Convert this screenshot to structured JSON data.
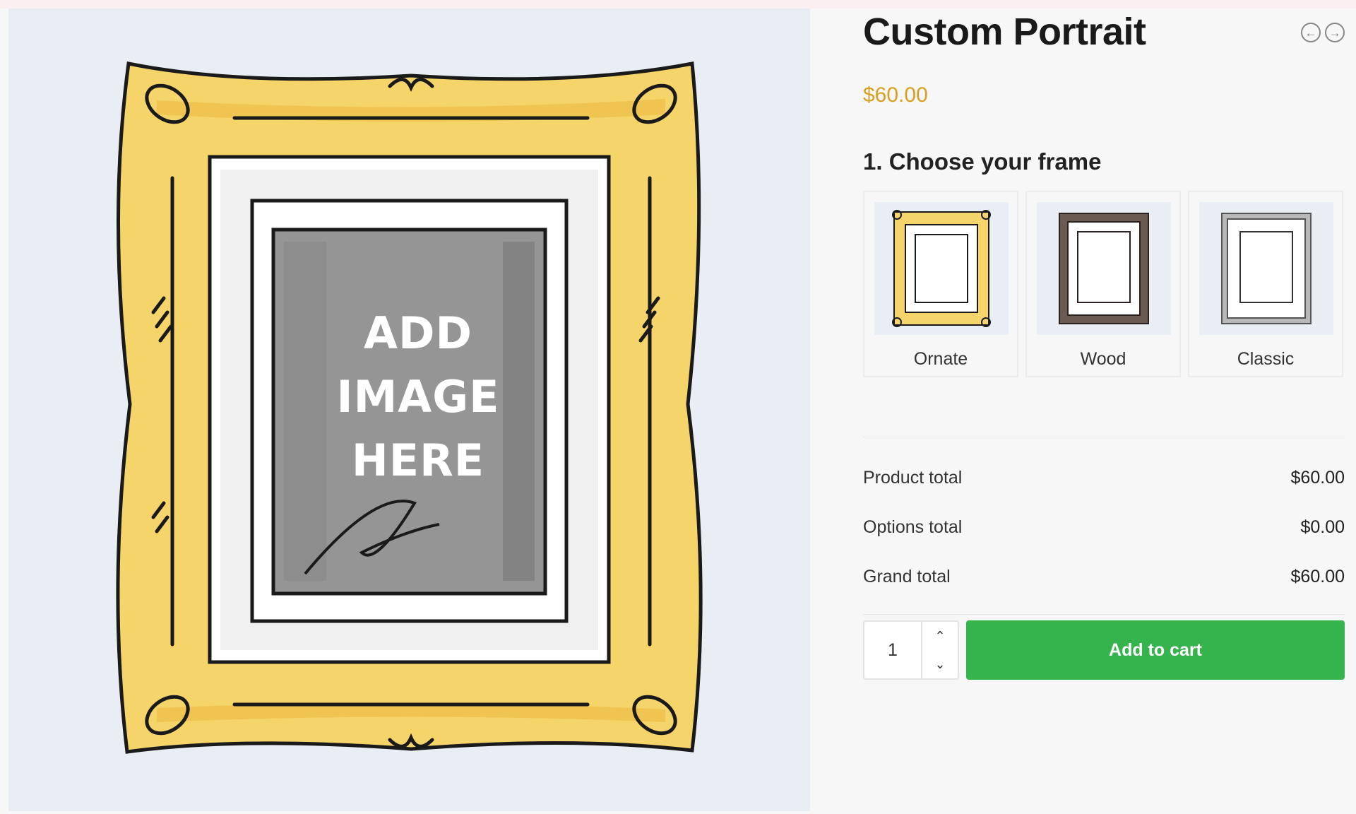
{
  "product": {
    "title": "Custom Portrait",
    "price": "$60.00",
    "image_placeholder": [
      "ADD",
      "IMAGE",
      "HERE"
    ]
  },
  "nav": {
    "prev_icon": "arrow-left-circle-icon",
    "next_icon": "arrow-right-circle-icon"
  },
  "options": {
    "heading": "1. Choose your frame",
    "frames": [
      {
        "label": "Ornate",
        "color": "#f2c94c"
      },
      {
        "label": "Wood",
        "color": "#6b5a52"
      },
      {
        "label": "Classic",
        "color": "#b8b8b8"
      }
    ]
  },
  "totals": {
    "product_label": "Product total",
    "product_value": "$60.00",
    "options_label": "Options total",
    "options_value": "$0.00",
    "grand_label": "Grand total",
    "grand_value": "$60.00"
  },
  "cart": {
    "quantity": "1",
    "button_label": "Add to cart"
  },
  "colors": {
    "price": "#d9a01f",
    "button": "#35b34d",
    "frame_gold": "#f5d46a"
  }
}
